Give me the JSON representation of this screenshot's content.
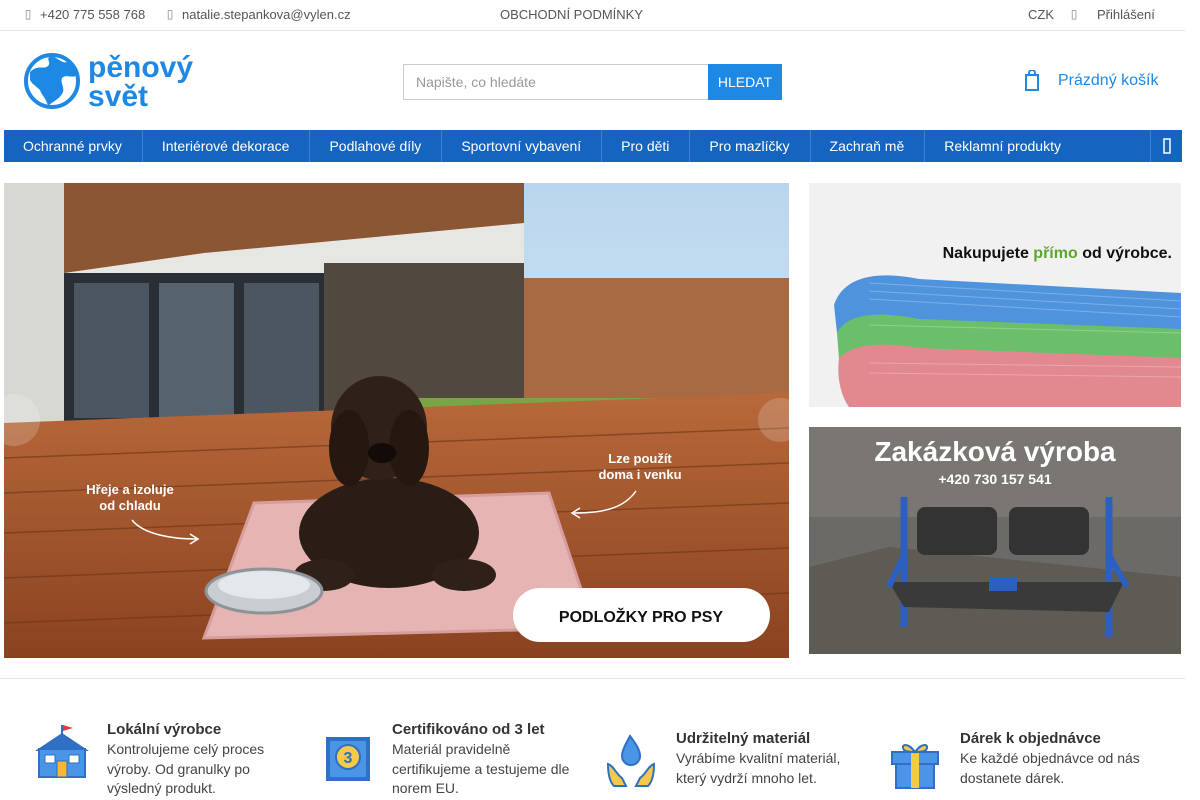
{
  "topbar": {
    "phone": "+420 775 558 768",
    "email": "natalie.stepankova@vylen.cz",
    "terms": "OBCHODNÍ PODMÍNKY",
    "currency": "CZK",
    "login": "Přihlášení"
  },
  "logo": {
    "line1": "pěnový",
    "line2": "svět"
  },
  "search": {
    "placeholder": "Napište, co hledáte",
    "button": "HLEDAT"
  },
  "cart": {
    "label": "Prázdný košík"
  },
  "nav": {
    "items": [
      "Ochranné prvky",
      "Interiérové dekorace",
      "Podlahové díly",
      "Sportovní vybavení",
      "Pro děti",
      "Pro mazlíčky",
      "Zachraň mě",
      "Reklamní produkty"
    ]
  },
  "main_banner": {
    "left_caption": "Hřeje a izoluje od chladu",
    "right_caption": "Lze použít doma i venku",
    "cta": "PODLOŽKY PRO PSY"
  },
  "side_banner_1": {
    "text_before": "Nakupujete ",
    "text_highlight": "přímo",
    "text_after": " od výrobce."
  },
  "side_banner_2": {
    "title": "Zakázková výroba",
    "phone": "+420 730 157 541"
  },
  "benefits": [
    {
      "title": "Lokální výrobce",
      "text": "Kontrolujeme celý proces výroby. Od granulky po výsledný produkt.",
      "icon": "factory-icon"
    },
    {
      "title": "Certifikováno od 3 let",
      "text": "Materiál pravidelně certifikujeme a testujeme dle norem EU.",
      "icon": "certificate-icon"
    },
    {
      "title": "Udržitelný materiál",
      "text": "Vyrábíme kvalitní materiál, který vydrží mnoho let.",
      "icon": "sustainable-icon"
    },
    {
      "title": "Dárek k objednávce",
      "text": "Ke každé objednávce od nás dostanete dárek.",
      "icon": "gift-icon"
    }
  ],
  "colors": {
    "brand": "#1e88e5",
    "nav": "#1565c0",
    "highlight": "#5aa82c"
  }
}
